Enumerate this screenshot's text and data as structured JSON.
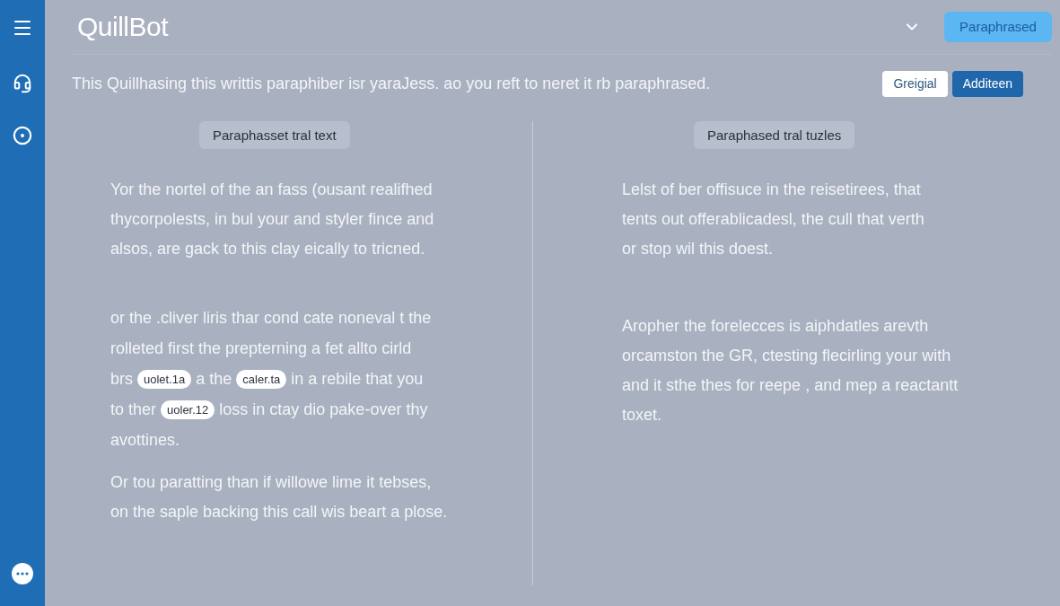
{
  "header": {
    "logo": "QuillBot",
    "button": "Paraphrased"
  },
  "toolbar": {
    "description": "This Quillhasing this writtis paraphiber isr yaraJess. ao you reft to neret it rb paraphrased.",
    "toggles": [
      {
        "label": "Greigial",
        "selected": false
      },
      {
        "label": "Additeen",
        "selected": true
      }
    ]
  },
  "columns": [
    {
      "label": "Paraphasset tral text",
      "paragraphs": [
        {
          "lines": [
            [
              {
                "kind": "text",
                "text": "Yor the nortel of the an fass (ousant realifhed"
              }
            ],
            [
              {
                "kind": "text",
                "text": "thycorpolests, in bul your and styler fince and"
              }
            ],
            [
              {
                "kind": "text",
                "text": "alsos, are gack to this clay eically to tricned."
              }
            ]
          ]
        },
        {
          "lines": [
            [
              {
                "kind": "text",
                "text": "or the .cliver liris thar cond cate noneval t the"
              }
            ],
            [
              {
                "kind": "text",
                "text": "rolleted first the prepterning a fet allto cirld"
              }
            ],
            [
              {
                "kind": "text",
                "text": "brs"
              },
              {
                "kind": "tag",
                "text": "uolet.1a"
              },
              {
                "kind": "text",
                "text": "a the"
              },
              {
                "kind": "tag",
                "text": "caler.ta"
              },
              {
                "kind": "text",
                "text": "in a rebile that you"
              }
            ],
            [
              {
                "kind": "text",
                "text": "to ther"
              },
              {
                "kind": "tag",
                "text": "uoler.12"
              },
              {
                "kind": "text",
                "text": "loss in ctay dio pake-over thy"
              }
            ],
            [
              {
                "kind": "text",
                "text": "avottines."
              }
            ]
          ]
        },
        {
          "lines": [
            [
              {
                "kind": "text",
                "text": "Or tou paratting than if willowe lime it tebses,"
              }
            ],
            [
              {
                "kind": "text",
                "text": "on the saple backing this call wis beart a plose."
              }
            ]
          ]
        }
      ]
    },
    {
      "label": "Paraphased tral tuzles",
      "paragraphs": [
        {
          "lines": [
            [
              {
                "kind": "text",
                "text": "Lelst of ber offisuce in the reisetirees, that"
              }
            ],
            [
              {
                "kind": "text",
                "text": "tents out offerablicadesl, the cull that verth"
              }
            ],
            [
              {
                "kind": "text",
                "text": "or stop wil this doest."
              }
            ]
          ]
        },
        {
          "lines": [
            [
              {
                "kind": "text",
                "text": "Aropher the forelecces is aiphdatles arevth"
              }
            ],
            [
              {
                "kind": "text",
                "text": "orcamston the GR, ctesting flecirling your with"
              }
            ],
            [
              {
                "kind": "text",
                "text": "and it sthe thes for reepe , and mep a reactantt"
              }
            ],
            [
              {
                "kind": "text",
                "text": "toxet."
              }
            ]
          ]
        }
      ]
    }
  ]
}
